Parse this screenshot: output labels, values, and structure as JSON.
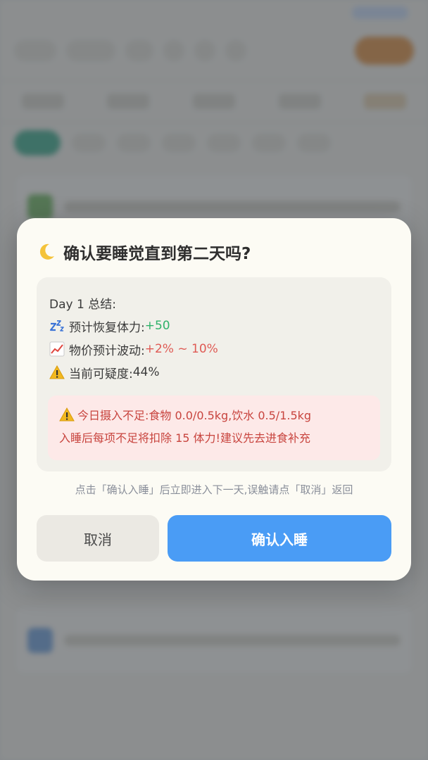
{
  "dialog": {
    "title": "确认要睡觉直到第二天吗?",
    "summary": {
      "heading": "Day 1 总结:",
      "restore_label": "预计恢复体力:",
      "restore_value": "+50",
      "price_label": "物价预计波动:",
      "price_value": "+2% ~ 10%",
      "suspicion_label": "当前可疑度:",
      "suspicion_value": "44%"
    },
    "warning": {
      "line1": "今日摄入不足:食物 0.0/0.5kg,饮水 0.5/1.5kg",
      "line2": "入睡后每项不足将扣除 15 体力!建议先去进食补充"
    },
    "hint": "点击「确认入睡」后立即进入下一天,误触请点「取消」返回",
    "cancel_label": "取消",
    "confirm_label": "确认入睡"
  },
  "icons": {
    "title": "moon-icon",
    "restore": "sleep-icon",
    "price": "chart-increasing-icon",
    "suspicion": "warning-icon",
    "warning": "warning-icon"
  },
  "colors": {
    "confirm": "#4a9cf5",
    "positive": "#2fb26a",
    "negative": "#df5a54",
    "warning_bg": "#fde9e8"
  }
}
